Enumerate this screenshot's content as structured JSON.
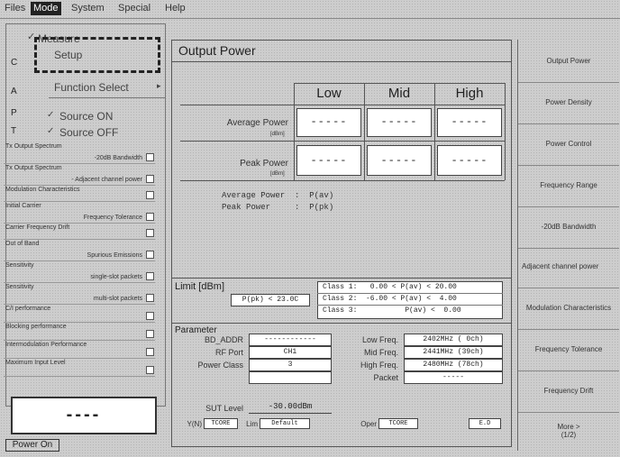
{
  "menu": [
    "Files",
    "Mode",
    "System",
    "Special",
    "Help"
  ],
  "dropdown": {
    "items": [
      "Measure",
      "Setup",
      "Function Select",
      "Source ON",
      "Source OFF"
    ],
    "check_mark": "✓",
    "submenu_arrow": "▸"
  },
  "left_panel": {
    "side_labels": [
      "C",
      "A",
      "P",
      "T"
    ],
    "tests": [
      {
        "l1": "Tx Output Spectrum",
        "l2": "-20dB Bandwidth"
      },
      {
        "l1": "Tx Output Spectrum",
        "l2": "- Adjacent channel power"
      },
      {
        "l1": "Modulation Characteristics",
        "l2": ""
      },
      {
        "l1": "Initial Carrier",
        "l2": "Frequency Tolerance"
      },
      {
        "l1": "Carrier Frequency Drift",
        "l2": ""
      },
      {
        "l1": "Out of Band",
        "l2": "Spurious Emissions"
      },
      {
        "l1": "Sensitivity",
        "l2": "single-slot packets"
      },
      {
        "l1": "Sensitivity",
        "l2": "multi-slot packets"
      },
      {
        "l1": "C/I performance",
        "l2": ""
      },
      {
        "l1": "Blocking performance",
        "l2": ""
      },
      {
        "l1": "Intermodulation Performance",
        "l2": ""
      },
      {
        "l1": "Maximum Input Level",
        "l2": ""
      }
    ],
    "result": "----"
  },
  "main": {
    "title": "Output Power",
    "columns": [
      "Low",
      "Mid",
      "High"
    ],
    "rows": [
      {
        "label": "Average Power",
        "unit": "[dBm]",
        "values": [
          "-----",
          "-----",
          "-----"
        ]
      },
      {
        "label": "Peak Power",
        "unit": "[dBm]",
        "values": [
          "-----",
          "-----",
          "-----"
        ]
      }
    ],
    "formula_1": "Average Power  :  P(av)",
    "formula_2": "Peak Power     :  P(pk)",
    "limit": {
      "title": "Limit  [dBm]",
      "pk_rule": "P(pk) < 23.0C",
      "classes": [
        "Class 1:   0.00 < P(av) < 20.00",
        "Class 2:  -6.00 < P(av) <  4.00",
        "Class 3:           P(av) <  0.00"
      ]
    },
    "parameter": {
      "title": "Parameter",
      "left": [
        {
          "label": "BD_ADDR",
          "value": "------------"
        },
        {
          "label": "RF Port",
          "value": "CH1"
        },
        {
          "label": "Power Class",
          "value": "3"
        },
        {
          "label": "",
          "value": ""
        }
      ],
      "right": [
        {
          "label": "Low Freq.",
          "value": "2402MHz ( 0ch)"
        },
        {
          "label": "Mid Freq.",
          "value": "2441MHz (39ch)"
        },
        {
          "label": "High Freq.",
          "value": "2480MHz (78ch)"
        },
        {
          "label": "Packet",
          "value": "-----"
        }
      ],
      "sut_label": "SUT Level",
      "sut_value": "-30.00dBm",
      "bottom": [
        {
          "label": "Y(N)",
          "value": "TCORE"
        },
        {
          "label": "Lim",
          "value": "Default"
        },
        {
          "label": "Oper",
          "value": "TCORE"
        },
        {
          "label": "",
          "value": "E.D"
        }
      ]
    }
  },
  "right_panel": [
    "Output Power",
    "Power Density",
    "Power Control",
    "Frequency Range",
    "-20dB Bandwidth",
    "Adjacent channel power",
    "Modulation Characteristics",
    "Frequency Tolerance",
    "Frequency Drift",
    "More >"
  ],
  "right_panel_more_sub": "(1/2)",
  "power_on": "Power On"
}
